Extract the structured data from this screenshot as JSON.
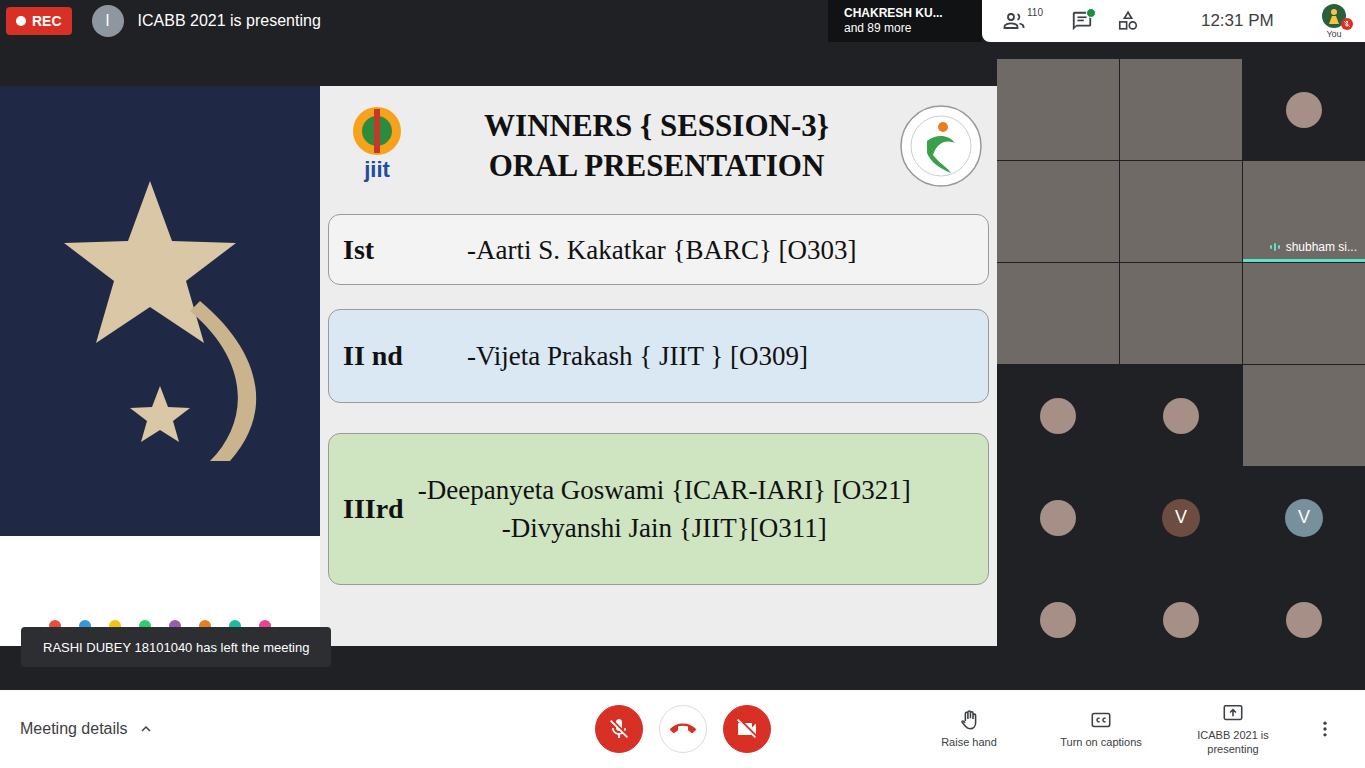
{
  "top_bar": {
    "recording_label": "REC",
    "presenter": {
      "initial": "I",
      "text": "ICABB 2021 is presenting"
    },
    "participants_preview": {
      "name": "CHAKRESH KU...",
      "more": "and 89 more"
    },
    "people_count": "110",
    "chat_unread": true,
    "time": "12:31 PM",
    "self": {
      "label": "You",
      "muted": true
    }
  },
  "slide": {
    "logo_text": "jiit",
    "title": "WINNERS { SESSION-3}",
    "subtitle": "ORAL PRESENTATION",
    "winners": [
      {
        "place": "Ist",
        "entries": [
          "-Aarti S. Kakatkar {BARC} [O303]"
        ],
        "color": "#f3f3f3"
      },
      {
        "place": "II nd",
        "entries": [
          "-Vijeta Prakash { JIIT } [O309]"
        ],
        "color": "#dae8f4"
      },
      {
        "place": "IIIrd",
        "entries": [
          "-Deepanyeta Goswami {ICAR-IARI} [O321]",
          "-Divyanshi Jain {JIIT}[O311]"
        ],
        "color": "#cfe4c1"
      }
    ]
  },
  "toast": "RASHI DUBEY 18101040 has left the meeting",
  "tiles": [
    {
      "kind": "video",
      "speaking": false
    },
    {
      "kind": "video",
      "speaking": false
    },
    {
      "kind": "photo",
      "speaking": false
    },
    {
      "kind": "video",
      "speaking": false
    },
    {
      "kind": "video",
      "speaking": false
    },
    {
      "kind": "video",
      "speaking": true,
      "name": "shubham si..."
    },
    {
      "kind": "video",
      "speaking": false
    },
    {
      "kind": "video",
      "speaking": false
    },
    {
      "kind": "video",
      "speaking": false
    },
    {
      "kind": "photo",
      "speaking": false
    },
    {
      "kind": "photo",
      "speaking": false
    },
    {
      "kind": "video",
      "speaking": false
    },
    {
      "kind": "photo",
      "speaking": false
    },
    {
      "kind": "letter",
      "letter": "V",
      "color": "#6d4c41",
      "speaking": false
    },
    {
      "kind": "letter",
      "letter": "V",
      "color": "#78909c",
      "speaking": false
    },
    {
      "kind": "photo",
      "speaking": false
    },
    {
      "kind": "photo",
      "speaking": false
    },
    {
      "kind": "photo",
      "speaking": false
    }
  ],
  "bottom_bar": {
    "meeting_details": "Meeting details",
    "mic_muted": true,
    "camera_off": true,
    "actions": [
      {
        "label": "Raise hand",
        "icon": "hand"
      },
      {
        "label": "Turn on captions",
        "icon": "captions"
      },
      {
        "label": "ICABB 2021 is presenting",
        "icon": "present"
      }
    ]
  }
}
